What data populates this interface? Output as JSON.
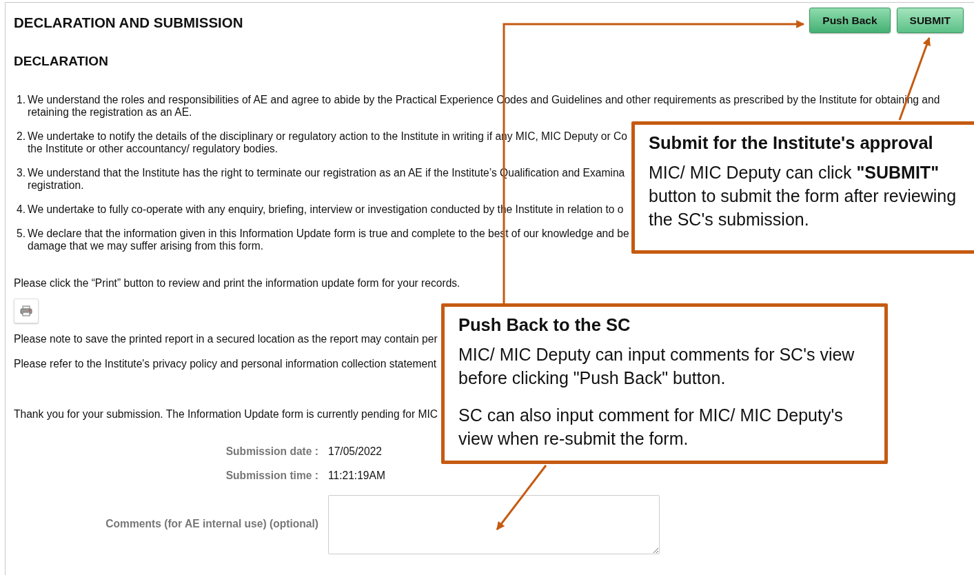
{
  "header": {
    "title": "DECLARATION AND SUBMISSION",
    "buttons": [
      {
        "label": "Push Back"
      },
      {
        "label": "SUBMIT"
      }
    ]
  },
  "declaration": {
    "heading": "DECLARATION",
    "items": [
      {
        "number": "1.",
        "lines": [
          "We understand the roles and responsibilities of AE and agree to abide by the Practical Experience Codes and Guidelines and other requirements as prescribed by the Institute for obtaining and",
          "retaining the registration as an AE."
        ]
      },
      {
        "number": "2.",
        "lines": [
          "We undertake to notify the details of the disciplinary or regulatory action to the Institute in writing if any MIC, MIC Deputy or Co",
          "the Institute or other accountancy/ regulatory bodies."
        ]
      },
      {
        "number": "3.",
        "lines": [
          "We understand that the Institute has the right to terminate our registration as an AE if the Institute’s Qualification and Examina",
          "registration."
        ]
      },
      {
        "number": "4.",
        "lines": [
          "We undertake to fully co-operate with any enquiry, briefing, interview or investigation conducted by the Institute in relation to o"
        ]
      },
      {
        "number": "5.",
        "lines": [
          "We declare that the information given in this Information Update form is true and complete to the best of our knowledge and be",
          "damage that we may suffer arising from this form."
        ]
      }
    ]
  },
  "print_note": "Please click the “Print” button to review and print the information update form for your records.",
  "notes": [
    "Please note to save the printed report in a secured location as the report may contain per",
    "Please refer to the Institute's privacy policy and personal information collection statement"
  ],
  "status_message": "Thank you for your submission. The Information Update form is currently pending for MIC",
  "fields": [
    {
      "label": "Submission date :",
      "value": "17/05/2022"
    },
    {
      "label": "Submission time :",
      "value": "11:21:19AM"
    }
  ],
  "comments": {
    "label": "Comments (for AE internal use) (optional)"
  },
  "callouts": [
    {
      "title": "Submit for the Institute's approval",
      "paragraphs": [
        "MIC/ MIC Deputy can click **\"SUBMIT\"** button to submit the form after reviewing the SC's submission."
      ]
    },
    {
      "title": "Push Back to the SC",
      "paragraphs": [
        "MIC/ MIC Deputy can input comments for SC's view before clicking \"Push Back\" button.",
        "SC can also input comment for MIC/ MIC Deputy's view when re-submit the form."
      ]
    }
  ]
}
